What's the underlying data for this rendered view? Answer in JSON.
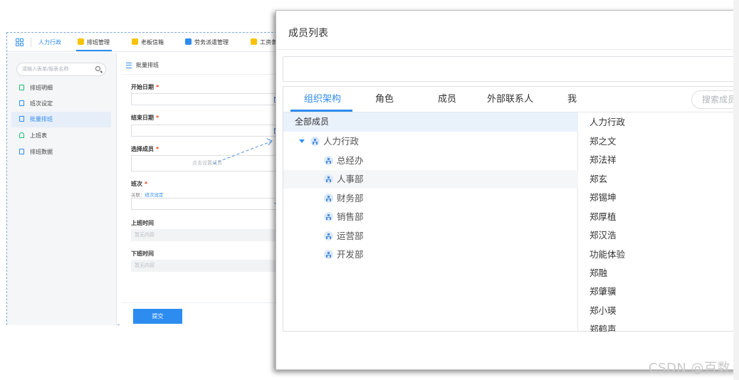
{
  "app": {
    "nav": {
      "items": [
        {
          "label": "人力行政",
          "icon": "none",
          "active": false
        },
        {
          "label": "排班管理",
          "icon": "yellow-square-icon",
          "active": true
        },
        {
          "label": "老板信箱",
          "icon": "yellow-square-icon",
          "active": false
        },
        {
          "label": "劳务派遣管理",
          "icon": "blue-send-icon",
          "active": false
        },
        {
          "label": "工资条",
          "icon": "yellow-square-icon",
          "active": false
        }
      ]
    },
    "sidebar": {
      "search_placeholder": "请输入表单/报表名称",
      "items": [
        {
          "label": "排班明细",
          "icon": "plus-doc-icon"
        },
        {
          "label": "班次设定",
          "icon": "doc-icon"
        },
        {
          "label": "批量排班",
          "icon": "doc-icon",
          "active": true
        },
        {
          "label": "上班表",
          "icon": "bell-icon"
        },
        {
          "label": "排班数据",
          "icon": "doc-icon"
        }
      ]
    },
    "form": {
      "title": "批量排班",
      "start_date_label": "开始日期",
      "end_date_label": "结束日期",
      "member_label": "选择成员",
      "member_placeholder": "点击设置成员",
      "shift_label": "班次",
      "related_prefix": "关联：",
      "related_link": "班次设定",
      "on_time_label": "上班时间",
      "on_time_value": "暂无内容",
      "off_time_label": "下班时间",
      "off_time_value": "暂无内容",
      "required_mark": "*",
      "submit_label": "提交"
    }
  },
  "modal": {
    "title": "成员列表",
    "tabs": [
      {
        "label": "组织架构",
        "active": true
      },
      {
        "label": "角色"
      },
      {
        "label": "成员"
      },
      {
        "label": "外部联系人"
      },
      {
        "label": "我"
      }
    ],
    "search_placeholder": "搜索成员",
    "tree": {
      "all_label": "全部成员",
      "root": "人力行政",
      "children": [
        "总经办",
        "人事部",
        "财务部",
        "销售部",
        "运营部",
        "开发部"
      ]
    },
    "members": [
      "人力行政",
      "郑之文",
      "郑法祥",
      "郑玄",
      "郑锡坤",
      "郑厚植",
      "郑汉浩",
      "功能体验",
      "郑融",
      "郑肇骥",
      "郑小瑛",
      "郑鹤声"
    ]
  },
  "watermark": "CSDN @百数",
  "colors": {
    "accent": "#2d8cf0",
    "required": "#ed4014",
    "highlight_bg": "#e9f1fb"
  }
}
